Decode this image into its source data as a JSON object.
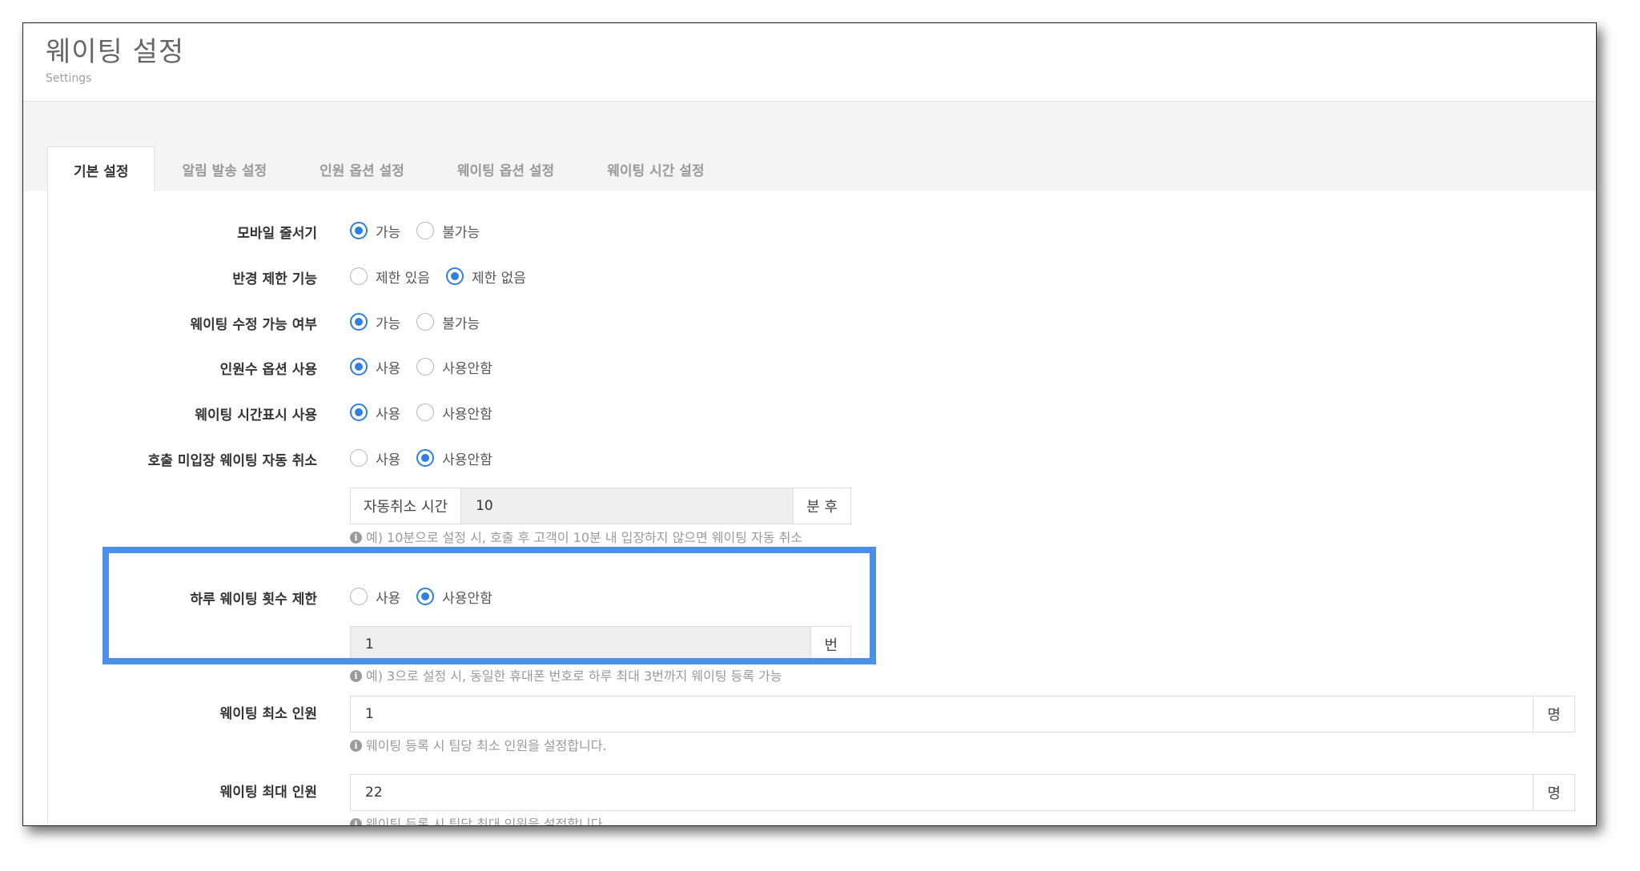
{
  "header": {
    "title": "웨이팅 설정",
    "subtitle": "Settings"
  },
  "tabs": [
    {
      "label": "기본 설정",
      "active": true
    },
    {
      "label": "알림 발송 설정",
      "active": false
    },
    {
      "label": "인원 옵션 설정",
      "active": false
    },
    {
      "label": "웨이팅 옵션 설정",
      "active": false
    },
    {
      "label": "웨이팅 시간 설정",
      "active": false
    }
  ],
  "settings": {
    "mobile_queue": {
      "label": "모바일 줄서기",
      "options": [
        "가능",
        "불가능"
      ],
      "selected": 0
    },
    "radius_limit": {
      "label": "반경 제한 기능",
      "options": [
        "제한 있음",
        "제한 없음"
      ],
      "selected": 1
    },
    "waiting_edit": {
      "label": "웨이팅 수정 가능 여부",
      "options": [
        "가능",
        "불가능"
      ],
      "selected": 0
    },
    "party_option": {
      "label": "인원수 옵션 사용",
      "options": [
        "사용",
        "사용안함"
      ],
      "selected": 0
    },
    "time_display": {
      "label": "웨이팅 시간표시 사용",
      "options": [
        "사용",
        "사용안함"
      ],
      "selected": 0
    },
    "auto_cancel": {
      "label": "호출 미입장 웨이팅 자동 취소",
      "options": [
        "사용",
        "사용안함"
      ],
      "selected": 1,
      "prefix": "자동취소 시간",
      "value": "10",
      "suffix": "분 후",
      "help": "예) 10분으로 설정 시, 호출 후 고객이 10분 내 입장하지 않으면 웨이팅 자동 취소"
    },
    "daily_limit": {
      "label": "하루 웨이팅 횟수 제한",
      "options": [
        "사용",
        "사용안함"
      ],
      "selected": 1,
      "value": "1",
      "suffix": "번",
      "help": "예) 3으로 설정 시, 동일한 휴대폰 번호로 하루 최대 3번까지 웨이팅 등록 가능"
    },
    "min_party": {
      "label": "웨이팅 최소 인원",
      "value": "1",
      "suffix": "명",
      "help": "웨이팅 등록 시 팀당 최소 인원을 설정합니다."
    },
    "max_party": {
      "label": "웨이팅 최대 인원",
      "value": "22",
      "suffix": "명",
      "help": "웨이팅 등록 시 팀당 최대 인원을 설정합니다."
    }
  },
  "colors": {
    "accent": "#2f7fe0",
    "highlight_border": "#4a90e8"
  }
}
